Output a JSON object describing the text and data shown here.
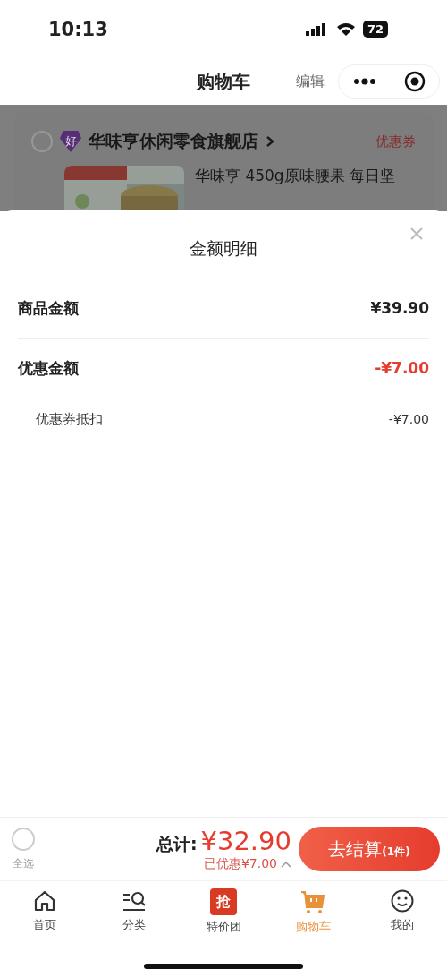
{
  "status_bar": {
    "time": "10:13",
    "battery": "72"
  },
  "nav": {
    "title": "购物车",
    "edit": "编辑"
  },
  "store": {
    "checked": false,
    "badge": "好",
    "name": "华味亨休闲零食旗舰店",
    "coupon": "优惠券"
  },
  "product": {
    "title": "华味亨 450g原味腰果 每日坚"
  },
  "sheet": {
    "title": "金额明细",
    "rows": [
      {
        "kind": "main",
        "label": "商品金额",
        "value": "¥39.90",
        "highlight": false
      },
      {
        "kind": "main",
        "label": "优惠金额",
        "value": "-¥7.00",
        "highlight": true
      },
      {
        "kind": "sub",
        "label": "优惠券抵扣",
        "value": "-¥7.00",
        "highlight": false
      }
    ]
  },
  "footer": {
    "select_all": {
      "label": "全选",
      "checked": false
    },
    "total_label": "总计:",
    "total": "¥32.90",
    "saved": "已优惠¥7.00",
    "expanded": true,
    "checkout": "去结算",
    "count": "(1件)"
  },
  "tabs": [
    {
      "kind": "home",
      "label": "首页",
      "selected": false
    },
    {
      "kind": "category",
      "label": "分类",
      "selected": false
    },
    {
      "kind": "deal",
      "label": "特价团",
      "badge": "抢",
      "selected": false
    },
    {
      "kind": "cart",
      "label": "购物车",
      "selected": true
    },
    {
      "kind": "me",
      "label": "我的",
      "selected": false
    }
  ]
}
